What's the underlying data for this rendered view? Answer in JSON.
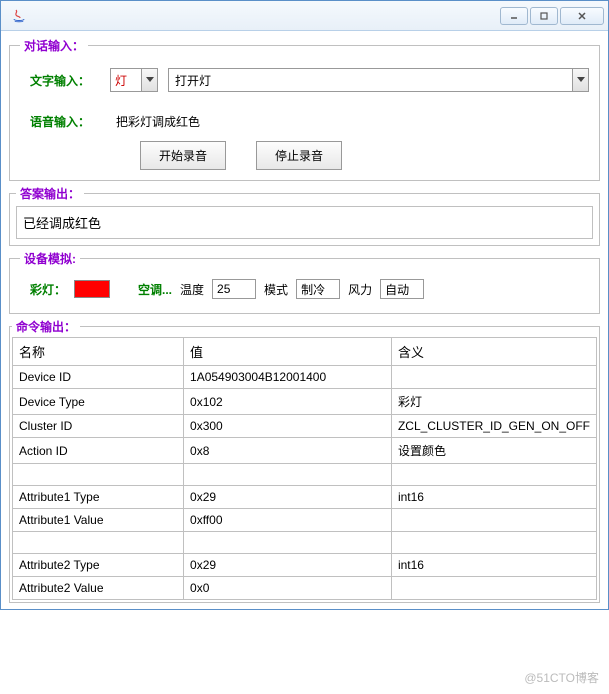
{
  "window": {
    "title": ""
  },
  "dialog_input": {
    "legend": "对话输入：",
    "text_label": "文字输入：",
    "device_select": "灯",
    "command_select": "打开灯",
    "voice_label": "语音输入：",
    "voice_text": "把彩灯调成红色",
    "start_record": "开始录音",
    "stop_record": "停止录音"
  },
  "answer_output": {
    "legend": "答案输出：",
    "text": "已经调成红色"
  },
  "device_sim": {
    "legend": "设备模拟:",
    "lamp_label": "彩灯：",
    "lamp_color": "#ff0000",
    "ac_label": "空调...",
    "temp_label": "温度",
    "temp_value": "25",
    "mode_label": "模式",
    "mode_value": "制冷",
    "wind_label": "风力",
    "wind_value": "自动"
  },
  "command_output": {
    "legend": "命令输出：",
    "headers": {
      "name": "名称",
      "value": "值",
      "meaning": "含义"
    },
    "rows": [
      {
        "name": "Device ID",
        "value": "1A054903004B12001400",
        "meaning": ""
      },
      {
        "name": "Device Type",
        "value": "0x102",
        "meaning": "彩灯"
      },
      {
        "name": "Cluster ID",
        "value": "0x300",
        "meaning": "ZCL_CLUSTER_ID_GEN_ON_OFF"
      },
      {
        "name": "Action ID",
        "value": "0x8",
        "meaning": "设置颜色"
      },
      {
        "name": "",
        "value": "",
        "meaning": ""
      },
      {
        "name": "Attribute1 Type",
        "value": "0x29",
        "meaning": "int16"
      },
      {
        "name": "Attribute1 Value",
        "value": "0xff00",
        "meaning": ""
      },
      {
        "name": "",
        "value": "",
        "meaning": ""
      },
      {
        "name": "Attribute2 Type",
        "value": "0x29",
        "meaning": "int16"
      },
      {
        "name": "Attribute2 Value",
        "value": "0x0",
        "meaning": ""
      }
    ]
  },
  "watermark": "@51CTO博客"
}
